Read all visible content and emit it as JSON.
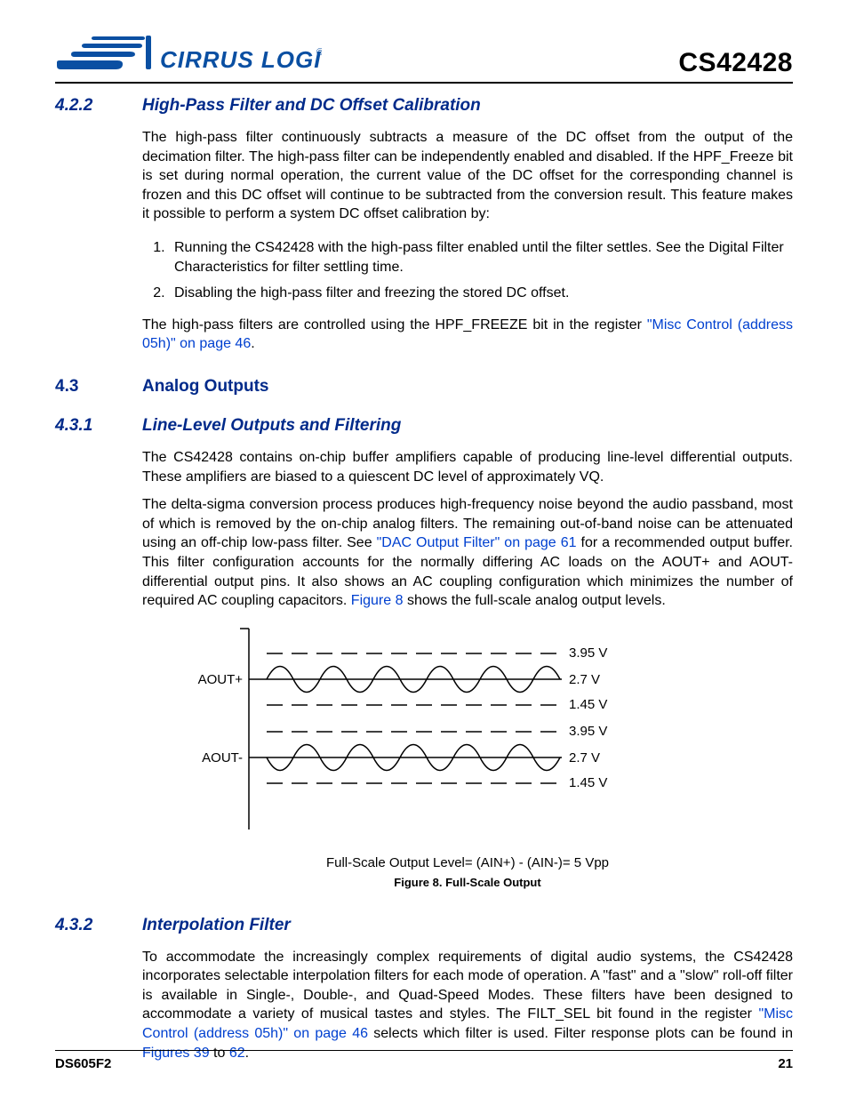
{
  "header": {
    "part_number": "CS42428",
    "brand_text": "CIRRUS LOGIC",
    "reg_mark": "®"
  },
  "s422": {
    "num": "4.2.2",
    "title": "High-Pass Filter and DC Offset Calibration",
    "p1": "The high-pass filter continuously subtracts a measure of the DC offset from the output of the decimation filter. The high-pass filter can be independently enabled and disabled. If the HPF_Freeze bit is set during normal operation, the current value of the DC offset for the corresponding channel is frozen and this DC offset will continue to be subtracted from the conversion result. This feature makes it possible to perform a system DC offset calibration by:",
    "li1": "Running the CS42428 with the high-pass filter enabled until the filter settles. See the Digital Filter Characteristics for filter settling time.",
    "li2": "Disabling the high-pass filter and freezing the stored DC offset.",
    "p2a": "The high-pass filters are controlled using the HPF_FREEZE bit in the register ",
    "p2link": "\"Misc Control (address 05h)\" on page 46",
    "p2b": "."
  },
  "s43": {
    "num": "4.3",
    "title": "Analog Outputs"
  },
  "s431": {
    "num": "4.3.1",
    "title": "Line-Level Outputs and Filtering",
    "p1": "The CS42428 contains on-chip buffer amplifiers capable of producing line-level differential outputs. These amplifiers are biased to a quiescent DC level of approximately VQ.",
    "p2a": "The delta-sigma conversion process produces high-frequency noise beyond the audio passband, most of which is removed by the on-chip analog filters. The remaining out-of-band noise can be attenuated using an off-chip low-pass filter. See ",
    "p2link1": "\"DAC Output Filter\" on page 61",
    "p2b": " for a recommended output buffer. This filter configuration accounts for the normally differing AC loads on the AOUT+ and AOUT- differential output pins. It also shows an AC coupling configuration which minimizes the number of required AC coupling capacitors. ",
    "p2link2": "Figure 8",
    "p2c": " shows the full-scale analog output levels."
  },
  "figure8": {
    "aout_plus": "AOUT+",
    "aout_minus": "AOUT-",
    "v_top": "3.95 V",
    "v_mid": "2.7 V",
    "v_bot": "1.45 V",
    "caption_line": "Full-Scale Output Level= (AIN+) - (AIN-)= 5 Vpp",
    "title": "Figure 8.  Full-Scale Output"
  },
  "s432": {
    "num": "4.3.2",
    "title": "Interpolation Filter",
    "p1a": "To accommodate the increasingly complex requirements of digital audio systems, the CS42428 incorporates selectable interpolation filters for each mode of operation. A \"fast\" and a \"slow\" roll-off filter is available in Single-, Double-, and Quad-Speed Modes. These filters have been designed to accommodate a variety of musical tastes and styles. The FILT_SEL bit found in the register ",
    "p1link1": "\"Misc Control (address 05h)\" on page 46",
    "p1b": " selects which filter is used. Filter response plots can be found in ",
    "p1link2": "Figures 39",
    "p1c": " to ",
    "p1link3": "62",
    "p1d": "."
  },
  "footer": {
    "doc": "DS605F2",
    "page": "21"
  },
  "chart_data": {
    "type": "line",
    "title": "Full-Scale Output",
    "series": [
      {
        "name": "AOUT+",
        "levels_v": {
          "high": 3.95,
          "mid": 2.7,
          "low": 1.45
        }
      },
      {
        "name": "AOUT-",
        "levels_v": {
          "high": 3.95,
          "mid": 2.7,
          "low": 1.45
        }
      }
    ],
    "full_scale_vpp": 5,
    "formula": "Full-Scale Output Level = (AIN+) - (AIN-) = 5 Vpp"
  }
}
